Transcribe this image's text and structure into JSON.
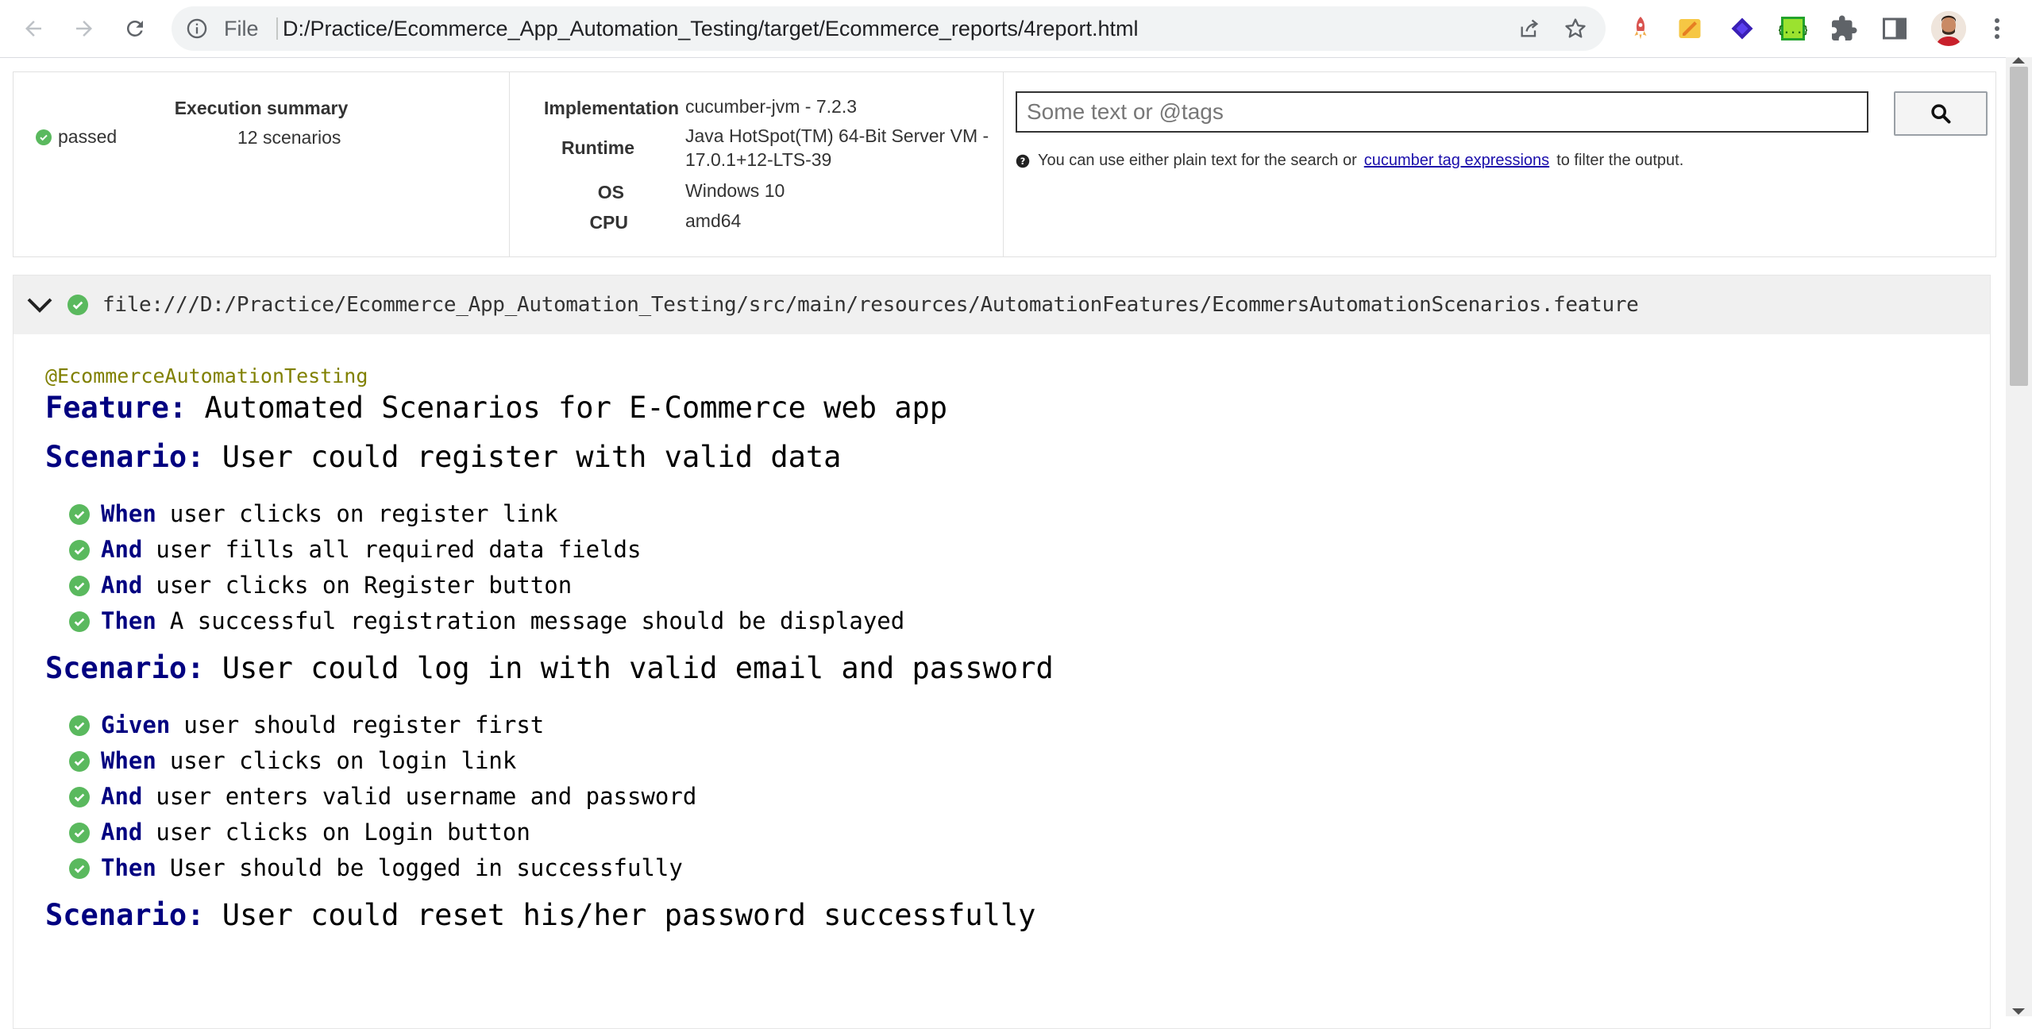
{
  "browser": {
    "file_label": "File",
    "url": "D:/Practice/Ecommerce_App_Automation_Testing/target/Ecommerce_reports/4report.html"
  },
  "summary": {
    "execution_title": "Execution summary",
    "status": "passed",
    "scenario_count": "12 scenarios",
    "implementation_label": "Implementation",
    "implementation_value": "cucumber-jvm - 7.2.3",
    "runtime_label": "Runtime",
    "runtime_value_line1": "Java HotSpot(TM) 64-Bit Server VM -",
    "runtime_value_line2": "17.0.1+12-LTS-39",
    "os_label": "OS",
    "os_value": "Windows 10",
    "cpu_label": "CPU",
    "cpu_value": "amd64"
  },
  "search": {
    "placeholder": "Some text or @tags",
    "help_before": "You can use either plain text for the search or",
    "help_link": "cucumber tag expressions",
    "help_after": "to filter the output."
  },
  "feature": {
    "path": "file:///D:/Practice/Ecommerce_App_Automation_Testing/src/main/resources/AutomationFeatures/EcommersAutomationScenarios.feature",
    "tag": "@EcommerceAutomationTesting",
    "keyword": "Feature:",
    "name": "Automated Scenarios for E-Commerce web app",
    "scenario_keyword": "Scenario:",
    "scenarios": [
      {
        "name": "User could register with valid data",
        "steps": [
          {
            "keyword": "When",
            "text": "user clicks on register link"
          },
          {
            "keyword": "And",
            "text": "user fills all required data fields"
          },
          {
            "keyword": "And",
            "text": "user clicks on Register button"
          },
          {
            "keyword": "Then",
            "text": "A successful registration message should be displayed"
          }
        ]
      },
      {
        "name": "User could log in with valid email and password",
        "steps": [
          {
            "keyword": "Given",
            "text": "user should register first"
          },
          {
            "keyword": "When",
            "text": "user clicks on login link"
          },
          {
            "keyword": "And",
            "text": "user enters valid username and password"
          },
          {
            "keyword": "And",
            "text": "user clicks on Login button"
          },
          {
            "keyword": "Then",
            "text": "User should be logged in successfully"
          }
        ]
      },
      {
        "name": "User could reset his/her password successfully",
        "steps": []
      }
    ]
  },
  "colors": {
    "passed": "#5ab95e",
    "keyword": "#000080",
    "tag": "#808000",
    "link": "#1a0dab"
  }
}
